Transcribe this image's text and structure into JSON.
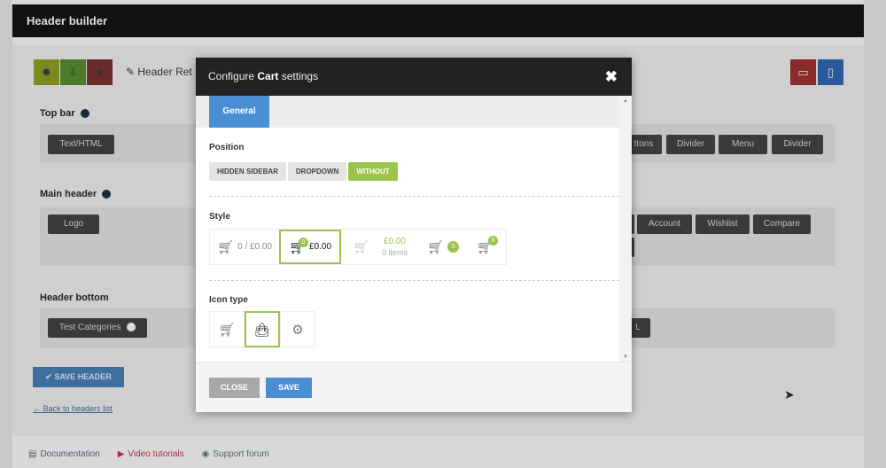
{
  "header": {
    "title": "Header builder",
    "header_name": "Header Ret"
  },
  "toolbar": {
    "settings_icon": "gear-icon",
    "download_icon": "download-icon",
    "star_icon": "star-icon",
    "desktop_icon": "desktop-icon",
    "mobile_icon": "mobile-icon"
  },
  "sections": {
    "top_bar": {
      "label": "Top bar",
      "left": [
        "Text/HTML"
      ],
      "right": [
        "ttons",
        "Divider",
        "Menu",
        "Divider"
      ]
    },
    "main_header": {
      "label": "Main header",
      "left": [
        "Logo"
      ],
      "right": [
        "Account",
        "Wishlist",
        "Compare"
      ]
    },
    "header_bottom": {
      "label": "Header bottom",
      "left": [
        "Test Categories"
      ],
      "right": [
        "L"
      ]
    }
  },
  "save_header": "SAVE HEADER",
  "back_link": "← Back to headers list",
  "footer": {
    "documentation": "Documentation",
    "video": "Video tutorials",
    "forum": "Support forum"
  },
  "modal": {
    "title_prefix": "Configure ",
    "title_bold": "Cart",
    "title_suffix": " settings",
    "close_glyph": "✖",
    "tab": "General",
    "position_label": "Position",
    "positions": [
      "HIDDEN SIDEBAR",
      "DROPDOWN",
      "WITHOUT"
    ],
    "active_position": "WITHOUT",
    "style_label": "Style",
    "style_opt1": "0 / £0.00",
    "style_opt2": "£0.00",
    "style_opt3_price": "£0.00",
    "style_opt3_items": "0 items",
    "badge_count": "0",
    "icon_type_label": "Icon type",
    "close_button": "CLOSE",
    "save_button": "SAVE"
  },
  "colors": {
    "accent_green": "#9ac44a",
    "accent_blue": "#4a8fd4",
    "header_dark": "#111111"
  }
}
